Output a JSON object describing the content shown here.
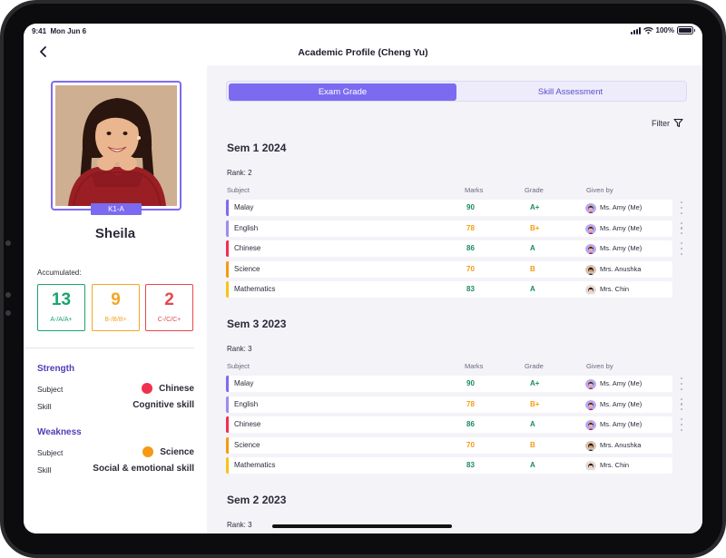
{
  "status_bar": {
    "time": "9:41",
    "date": "Mon Jun 6",
    "battery": "100%",
    "battery_level": 1.0
  },
  "header": {
    "title": "Academic Profile (Cheng Yu)",
    "back_icon": "chevron-left-icon"
  },
  "student": {
    "name": "Sheila",
    "class_badge": "K1-A"
  },
  "accumulated": {
    "label": "Accumulated:",
    "boxes": [
      {
        "count": "13",
        "grades": "A-/A/A+",
        "color": "#1aa36f"
      },
      {
        "count": "9",
        "grades": "B-/B/B+",
        "color": "#f5a524"
      },
      {
        "count": "2",
        "grades": "C-/C/C+",
        "color": "#e5484d"
      }
    ]
  },
  "strength": {
    "title": "Strength",
    "subject_label": "Subject",
    "subject": "Chinese",
    "subject_color": "#f0304f",
    "skill_label": "Skill",
    "skill": "Cognitive skill"
  },
  "weakness": {
    "title": "Weakness",
    "subject_label": "Subject",
    "subject": "Science",
    "subject_color": "#f59a12",
    "skill_label": "Skill",
    "skill": "Social & emotional skill"
  },
  "tabs": [
    {
      "label": "Exam Grade",
      "active": true
    },
    {
      "label": "Skill Assessment",
      "active": false
    }
  ],
  "filter": {
    "label": "Filter",
    "icon": "filter-icon"
  },
  "columns": {
    "subject": "Subject",
    "marks": "Marks",
    "grade": "Grade",
    "given_by": "Given by"
  },
  "semesters": [
    {
      "title": "Sem 1 2024",
      "rank": "Rank: 2",
      "rows": [
        {
          "subject": "Malay",
          "marks": "90",
          "grade": "A+",
          "given_by": "Ms. Amy (Me)",
          "color": "#7c6bf0",
          "mark_color": "#1a8a5c",
          "has_menu": true
        },
        {
          "subject": "English",
          "marks": "78",
          "grade": "B+",
          "given_by": "Ms. Amy (Me)",
          "color": "#9b8cf5",
          "mark_color": "#f59a12",
          "has_menu": true
        },
        {
          "subject": "Chinese",
          "marks": "86",
          "grade": "A",
          "given_by": "Ms. Amy (Me)",
          "color": "#f0304f",
          "mark_color": "#1a8a5c",
          "has_menu": true
        },
        {
          "subject": "Science",
          "marks": "70",
          "grade": "B",
          "given_by": "Mrs. Anushka",
          "color": "#f59a12",
          "mark_color": "#f59a12",
          "has_menu": false
        },
        {
          "subject": "Mathematics",
          "marks": "83",
          "grade": "A",
          "given_by": "Mrs. Chin",
          "color": "#f5c518",
          "mark_color": "#1a8a5c",
          "has_menu": false
        }
      ]
    },
    {
      "title": "Sem 3 2023",
      "rank": "Rank: 3",
      "rows": [
        {
          "subject": "Malay",
          "marks": "90",
          "grade": "A+",
          "given_by": "Ms. Amy (Me)",
          "color": "#7c6bf0",
          "mark_color": "#1a8a5c",
          "has_menu": true
        },
        {
          "subject": "English",
          "marks": "78",
          "grade": "B+",
          "given_by": "Ms. Amy (Me)",
          "color": "#9b8cf5",
          "mark_color": "#f59a12",
          "has_menu": true
        },
        {
          "subject": "Chinese",
          "marks": "86",
          "grade": "A",
          "given_by": "Ms. Amy (Me)",
          "color": "#f0304f",
          "mark_color": "#1a8a5c",
          "has_menu": true
        },
        {
          "subject": "Science",
          "marks": "70",
          "grade": "B",
          "given_by": "Mrs. Anushka",
          "color": "#f59a12",
          "mark_color": "#f59a12",
          "has_menu": false
        },
        {
          "subject": "Mathematics",
          "marks": "83",
          "grade": "A",
          "given_by": "Mrs. Chin",
          "color": "#f5c518",
          "mark_color": "#1a8a5c",
          "has_menu": false
        }
      ]
    },
    {
      "title": "Sem 2 2023",
      "rank": "Rank: 3",
      "rows": []
    }
  ]
}
